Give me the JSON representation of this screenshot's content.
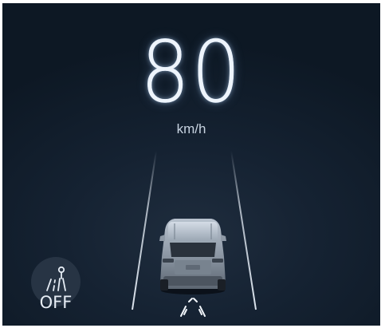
{
  "cluster": {
    "speed": "80",
    "unit": "km/h",
    "lane_keep_status": "OFF"
  },
  "colors": {
    "background": "#0d1824",
    "text": "#eef4fb",
    "lane_line": "#e6eef7"
  },
  "icons": {
    "lane_keep": "lane-keep-assist-icon",
    "driver_assist": "driver-assist-indicator-icon"
  }
}
